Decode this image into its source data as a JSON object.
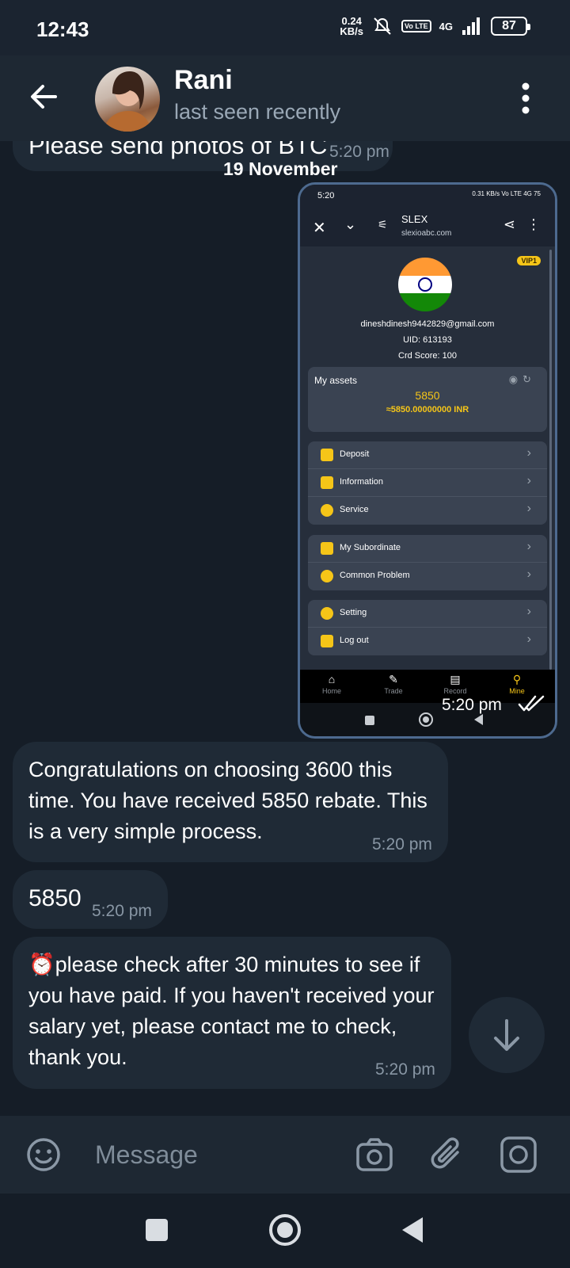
{
  "status_bar": {
    "time": "12:43",
    "net_speed_value": "0.24",
    "net_speed_unit": "KB/s",
    "volte": "Vo LTE",
    "network": "4G",
    "battery": "87"
  },
  "header": {
    "contact_name": "Rani",
    "contact_status": "last seen recently"
  },
  "chat": {
    "partial_message": {
      "text": "Please send photos of BTC",
      "time": "5:20 pm"
    },
    "date_separator": "19 November",
    "image_message": {
      "time": "5:20 pm",
      "screenshot": {
        "status_time": "5:20",
        "status_right": "0.31 KB/s  Vo LTE 4G  75",
        "site_name": "SLEX",
        "site_url": "slexioabc.com",
        "vip_badge": "VIP1",
        "email": "dineshdinesh9442829@gmail.com",
        "uid": "UID: 613193",
        "credit_score": "Crd Score: 100",
        "assets_label": "My assets",
        "assets_amount": "5850",
        "assets_inr": "≈5850.00000000 INR",
        "menu_groups": [
          [
            "Deposit",
            "Information",
            "Service"
          ],
          [
            "My Subordinate",
            "Common Problem"
          ],
          [
            "Setting",
            "Log out"
          ]
        ],
        "tabs": [
          "Home",
          "Trade",
          "Record",
          "Mine"
        ],
        "active_tab": "Mine"
      }
    },
    "messages": [
      {
        "text": "Congratulations on choosing 3600 this time. You have received 5850 rebate. This is a very simple process.",
        "time": "5:20 pm"
      },
      {
        "text": "5850",
        "time": "5:20 pm"
      },
      {
        "text": "⏰please check after 30 minutes to see if you have paid. If you haven't received your salary yet, please contact me to check, thank you.",
        "time": "5:20 pm"
      }
    ]
  },
  "composer": {
    "placeholder": "Message"
  },
  "colors": {
    "background": "#151d27",
    "bubble": "#1f2a36",
    "header": "#1e2833",
    "accent_yellow": "#f5c518"
  }
}
